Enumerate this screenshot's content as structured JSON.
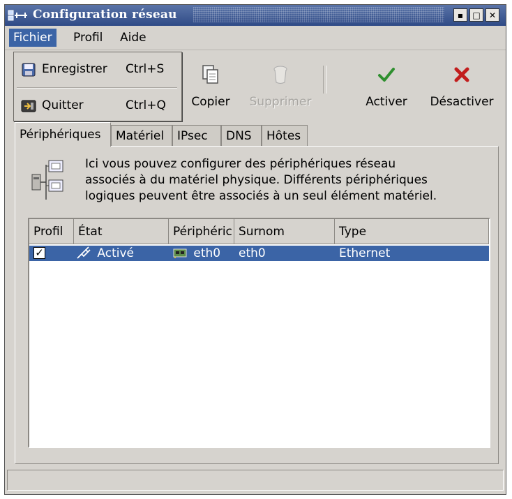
{
  "window": {
    "title": "Configuration réseau",
    "buttons": [
      "▪",
      "□",
      "✕"
    ]
  },
  "menubar": {
    "items": [
      {
        "label": "Fichier",
        "active": true
      },
      {
        "label": "Profil",
        "active": false
      },
      {
        "label": "Aide",
        "active": false
      }
    ]
  },
  "file_menu": {
    "items": [
      {
        "label": "Enregistrer",
        "shortcut": "Ctrl+S",
        "icon": "save-icon"
      },
      {
        "label": "Quitter",
        "shortcut": "Ctrl+Q",
        "icon": "quit-icon"
      }
    ]
  },
  "toolbar": {
    "copy_label": "Copier",
    "delete_label": "Supprimer",
    "activate_label": "Activer",
    "deactivate_label": "Désactiver"
  },
  "tabs": [
    {
      "label": "Périphériques",
      "active": true
    },
    {
      "label": "Matériel",
      "active": false
    },
    {
      "label": "IPsec",
      "active": false
    },
    {
      "label": "DNS",
      "active": false
    },
    {
      "label": "Hôtes",
      "active": false
    }
  ],
  "description": {
    "line1": "Ici vous pouvez configurer des périphériques réseau",
    "line2": "associés à du matériel physique. Différents périphériques",
    "line3": "logiques peuvent être associés à un seul élément matériel."
  },
  "device_table": {
    "columns": [
      "Profil",
      "État",
      "Périphéric",
      "Surnom",
      "Type"
    ],
    "rows": [
      {
        "profil_checked": true,
        "etat": "Activé",
        "peripherique": "eth0",
        "surnom": "eth0",
        "type": "Ethernet"
      }
    ]
  },
  "colors": {
    "titlebar": "#2f4a86",
    "selection": "#3b64a6",
    "window_bg": "#d6d3ce"
  }
}
